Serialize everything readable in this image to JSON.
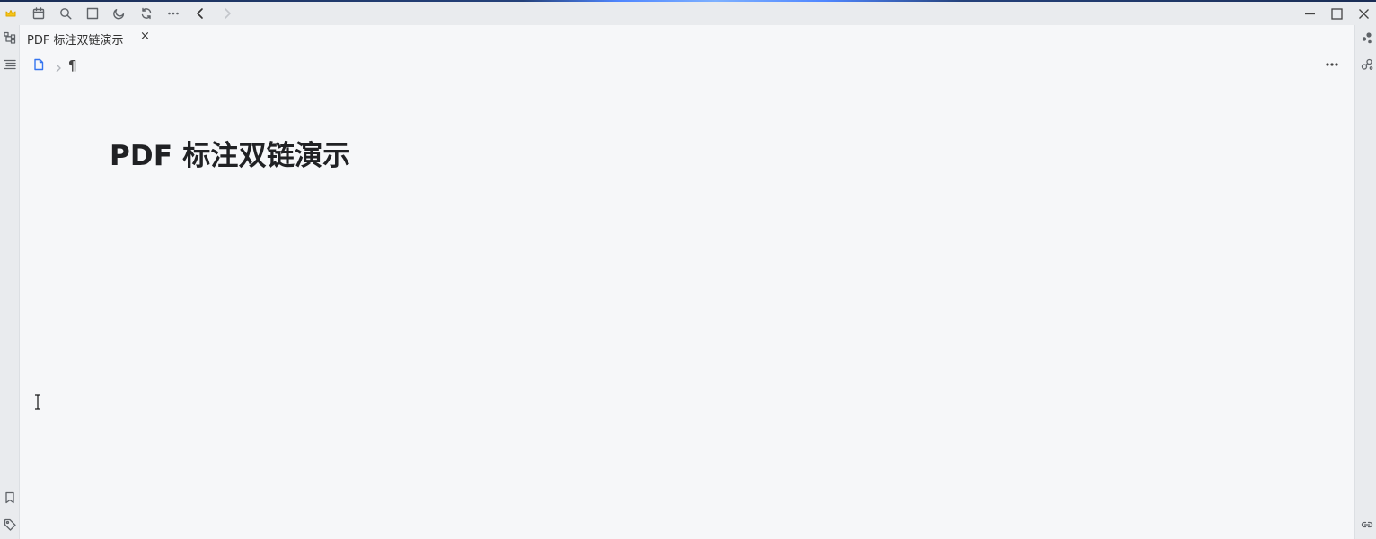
{
  "window": {
    "tab_title": "PDF 标注双链演示",
    "tab_close": "×",
    "toolbar_icons": [
      "crown-icon",
      "calendar-icon",
      "search-icon",
      "square-icon",
      "moon-icon",
      "sync-icon",
      "more-icon",
      "back-icon",
      "forward-icon"
    ],
    "window_controls": [
      "minimize-icon",
      "maximize-icon",
      "close-icon"
    ]
  },
  "left_dock": [
    "file-tree-icon",
    "outline-icon",
    "bookmark-icon",
    "tag-icon"
  ],
  "right_dock": [
    "graph-icon",
    "global-graph-icon",
    "backlink-icon"
  ],
  "breadcrumb": {
    "doc_icon": "document-icon",
    "separator": "chevron-right-icon",
    "block_symbol": "¶"
  },
  "document": {
    "title": "PDF 标注双链演示",
    "body": ""
  },
  "colors": {
    "accent": "#3575f0",
    "chrome": "#e9ebee",
    "editor_bg": "#f6f7f9",
    "crown": "#f5c518"
  }
}
